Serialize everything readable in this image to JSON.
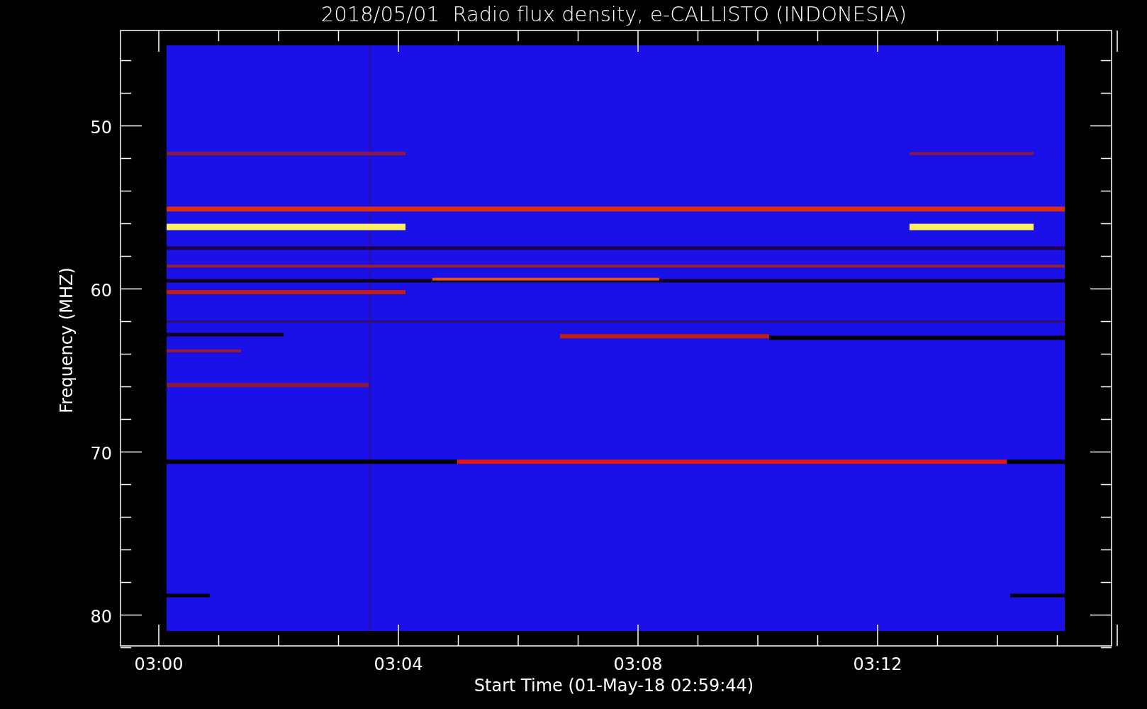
{
  "title": "2018/05/01  Radio flux density, e-CALLISTO (INDONESIA)",
  "y_axis": {
    "label": "Frequency (MHZ)",
    "ticks": [
      "50",
      "60",
      "70",
      "80"
    ]
  },
  "x_axis": {
    "label": "Start Time (01-May-18 02:59:44)",
    "ticks": [
      "03:00",
      "03:04",
      "03:08",
      "03:12"
    ]
  }
}
